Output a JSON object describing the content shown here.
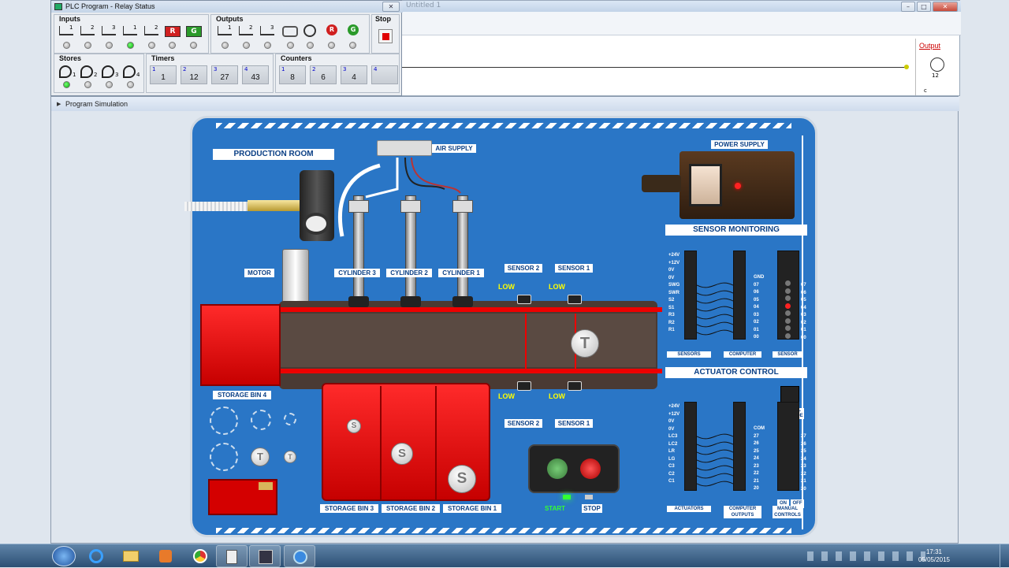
{
  "relay_window": {
    "title": "PLC Program - Relay Status",
    "inputs_label": "Inputs",
    "input_switch_labels": [
      "1",
      "2",
      "3",
      "1",
      "2"
    ],
    "input_buttons": [
      "R",
      "G"
    ],
    "outputs_label": "Outputs",
    "output_labels": [
      "1",
      "2",
      "3"
    ],
    "output_buttons": [
      "R",
      "G"
    ],
    "stop_label": "Stop",
    "stores_label": "Stores",
    "store_labels": [
      "1",
      "2",
      "3",
      "4"
    ],
    "timers_label": "Timers",
    "timers": [
      {
        "n": "1",
        "v": "1"
      },
      {
        "n": "2",
        "v": "12"
      },
      {
        "n": "3",
        "v": "27"
      },
      {
        "n": "4",
        "v": "43"
      }
    ],
    "counters_label": "Counters",
    "counters": [
      {
        "n": "1",
        "v": "8"
      },
      {
        "n": "2",
        "v": "6"
      },
      {
        "n": "3",
        "v": "4"
      },
      {
        "n": "4",
        "v": ""
      }
    ],
    "input_leds": [
      "off",
      "off",
      "off",
      "on",
      "off",
      "off",
      "off"
    ],
    "output_leds": [
      "off",
      "off",
      "off",
      "off",
      "off",
      "off",
      "off"
    ],
    "store_leds": [
      "on",
      "off",
      "off",
      "off"
    ]
  },
  "background_window": {
    "title": "Untitled 1",
    "output_label": "Output",
    "timer_value": "12",
    "timer_sub": "c"
  },
  "sim_window": {
    "title": "Program Simulation"
  },
  "board": {
    "production_room": "PRODUCTION ROOM",
    "air_supply": "AIR SUPPLY",
    "motor": "MOTOR",
    "cylinders": [
      "CYLINDER 3",
      "CYLINDER 2",
      "CYLINDER 1"
    ],
    "sensors_top": [
      "SENSOR 2",
      "SENSOR 1"
    ],
    "sensors_bottom": [
      "SENSOR 2",
      "SENSOR 1"
    ],
    "low": "LOW",
    "belt_shape": "T",
    "storage_bin_4": "STORAGE BIN 4",
    "storage_bins": [
      "STORAGE BIN 3",
      "STORAGE BIN 2",
      "STORAGE BIN 1"
    ],
    "bin_shapes": [
      "S",
      "S",
      "S"
    ],
    "loose_shapes": [
      "T",
      "T"
    ],
    "start": "START",
    "stop": "STOP",
    "power_supply": "POWER SUPPLY",
    "sensor_monitoring": "SENSOR MONITORING",
    "sm_left_labels": [
      "+24V",
      "+12V",
      "0V",
      "0V",
      "SWG",
      "SWR",
      "S2",
      "S1",
      "R3",
      "R2",
      "R1"
    ],
    "sm_mid_labels": [
      "GND",
      "07",
      "06",
      "05",
      "04",
      "03",
      "02",
      "01",
      "00"
    ],
    "sm_right_labels": [
      "07",
      "06",
      "05",
      "04",
      "03",
      "02",
      "01",
      "00"
    ],
    "sm_bottom_tags": [
      "SENSORS",
      "COMPUTER",
      "SENSOR"
    ],
    "actuator_control": "ACTUATOR CONTROL",
    "ac_left_labels": [
      "+24V",
      "+12V",
      "0V",
      "0V",
      "LC3",
      "LC2",
      "LR",
      "LG",
      "C3",
      "C2",
      "C1"
    ],
    "ac_mid_labels": [
      "COM",
      "27",
      "26",
      "25",
      "24",
      "23",
      "22",
      "21",
      "20"
    ],
    "ac_right_labels": [
      "27",
      "26",
      "25",
      "24",
      "23",
      "22",
      "21",
      "20"
    ],
    "manual_override": "MANUAL OVERRIDE",
    "on": "ON",
    "off": "OFF",
    "ac_bottom_tags": [
      "ACTUATORS",
      "COMPUTER OUTPUTS",
      "MANUAL CONTROLS"
    ]
  },
  "taskbar": {
    "time": "17:31",
    "date": "05/05/2015"
  },
  "colors": {
    "board": "#2a76c6",
    "bin": "#e00000",
    "led_on": "#00aa00",
    "red_button": "#e02020",
    "green_button": "#3a9a3a"
  }
}
